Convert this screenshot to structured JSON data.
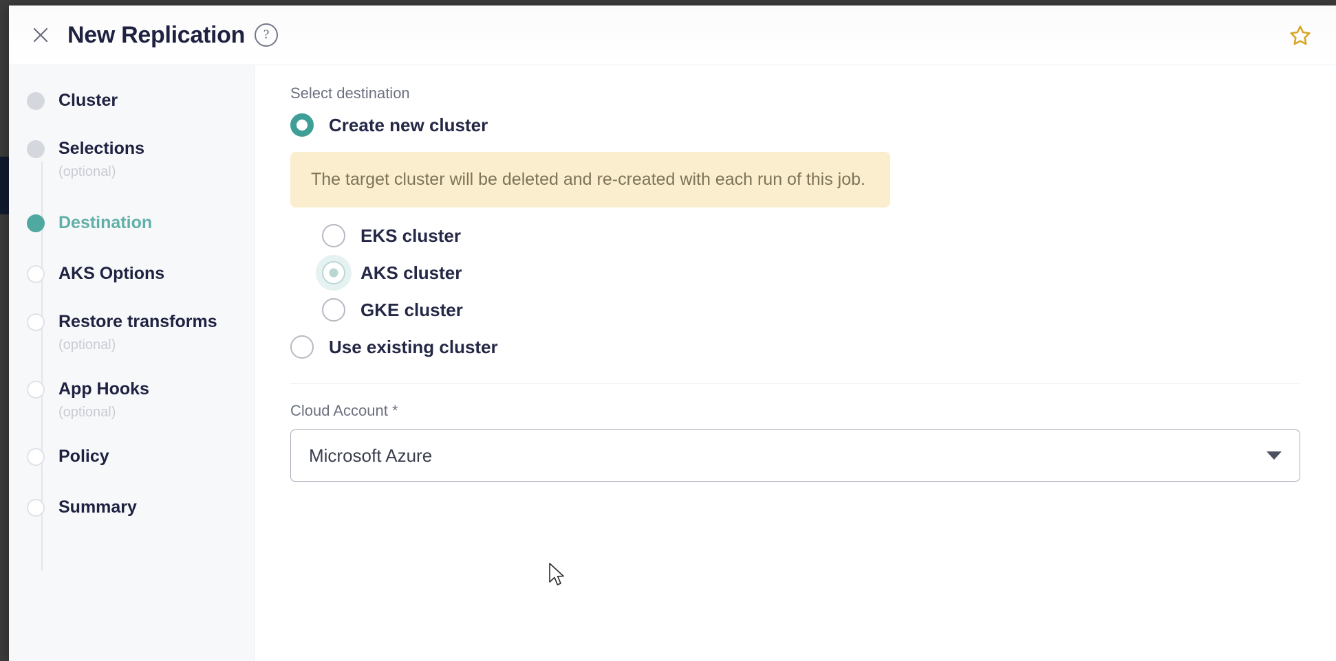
{
  "window": {
    "title": "New Replication",
    "close_icon": "close-icon",
    "help_icon": "help-circle-icon",
    "favorite_icon": "star-icon",
    "favorite_color": "#d9a520"
  },
  "theme": {
    "accent": "#4fa9a1",
    "accent_text": "#61b0a8",
    "banner_bg": "#faeece",
    "banner_text": "#7e7457",
    "sidebar_bg": "#f7f8fa",
    "title_color": "#1e2240"
  },
  "stepper": {
    "steps": [
      {
        "label": "Cluster",
        "sub": "",
        "state": "done"
      },
      {
        "label": "Selections",
        "sub": "(optional)",
        "state": "done"
      },
      {
        "label": "Destination",
        "sub": "",
        "state": "active"
      },
      {
        "label": "AKS Options",
        "sub": "",
        "state": "pending"
      },
      {
        "label": "Restore transforms",
        "sub": "(optional)",
        "state": "pending"
      },
      {
        "label": "App Hooks",
        "sub": "(optional)",
        "state": "pending"
      },
      {
        "label": "Policy",
        "sub": "",
        "state": "pending"
      },
      {
        "label": "Summary",
        "sub": "",
        "state": "pending"
      }
    ]
  },
  "main": {
    "section_label": "Select destination",
    "destination_options": [
      {
        "label": "Create new cluster",
        "selected": true
      },
      {
        "label": "Use existing cluster",
        "selected": false
      }
    ],
    "create_new_label": "Create new cluster",
    "use_existing_label": "Use existing cluster",
    "banner_text": "The target cluster will be deleted and re-created with each run of this job.",
    "cluster_types": [
      {
        "label": "EKS cluster",
        "selected": false
      },
      {
        "label": "AKS cluster",
        "selected": true
      },
      {
        "label": "GKE cluster",
        "selected": false
      }
    ],
    "cloud_account": {
      "label": "Cloud Account *",
      "value": "Microsoft Azure",
      "arrow_icon": "chevron-down-icon"
    }
  }
}
